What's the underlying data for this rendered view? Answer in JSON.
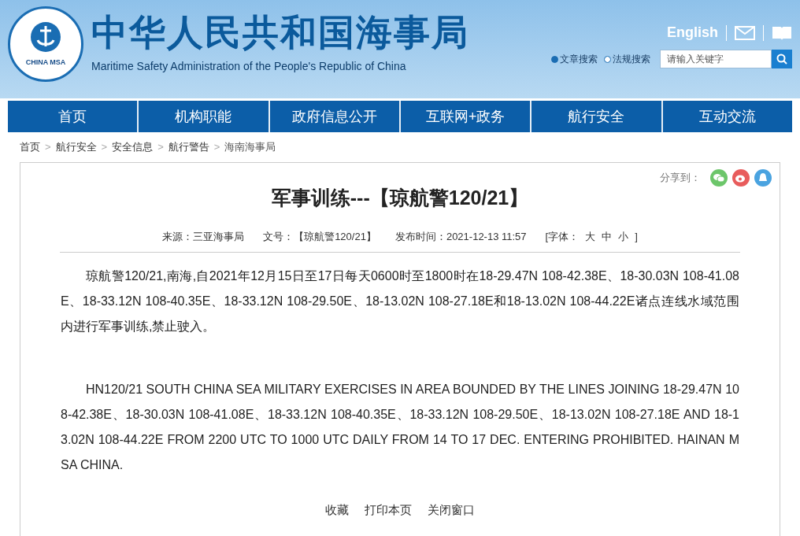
{
  "header": {
    "title": "中华人民共和国海事局",
    "subtitle": "Maritime Safety Administration of the People's Republic of China",
    "logo_text": "CHINA MSA",
    "language_link": "English",
    "search_scopes": [
      {
        "label": "文章搜索",
        "selected": true
      },
      {
        "label": "法规搜索",
        "selected": false
      }
    ],
    "search": {
      "placeholder": "请输入关键字"
    }
  },
  "nav": [
    {
      "label": "首页"
    },
    {
      "label": "机构职能"
    },
    {
      "label": "政府信息公开"
    },
    {
      "label": "互联网+政务"
    },
    {
      "label": "航行安全"
    },
    {
      "label": "互动交流"
    }
  ],
  "breadcrumb": {
    "separator": ">",
    "items": [
      "首页",
      "航行安全",
      "安全信息",
      "航行警告",
      "海南海事局"
    ]
  },
  "article": {
    "share_label": "分享到：",
    "title": "军事训练---【琼航警120/21】",
    "meta": [
      {
        "kind": "text",
        "text": "来源：三亚海事局"
      },
      {
        "kind": "text",
        "text": "文号：【琼航警120/21】"
      },
      {
        "kind": "text",
        "text": "发布时间：2021-12-13 11:57"
      },
      {
        "kind": "font",
        "label": "[字体：",
        "sizes": [
          "大",
          "中",
          "小"
        ],
        "close": "]"
      }
    ],
    "paragraphs": [
      "琼航警120/21,南海,自2021年12月15日至17日每天0600时至1800时在18-29.47N 108-42.38E、18-30.03N 108-41.08E、18-33.12N 108-40.35E、18-33.12N 108-29.50E、18-13.02N 108-27.18E和18-13.02N 108-44.22E诸点连线水域范围内进行军事训练,禁止驶入。",
      "HN120/21 SOUTH CHINA SEA MILITARY EXERCISES IN AREA BOUNDED BY THE LINES JOINING 18-29.47N 108-42.38E、18-30.03N 108-41.08E、18-33.12N 108-40.35E、18-33.12N 108-29.50E、18-13.02N 108-27.18E AND 18-13.02N 108-44.22E FROM 2200 UTC TO 1000 UTC DAILY FROM 14 TO 17 DEC. ENTERING PROHIBITED. HAINAN MSA CHINA."
    ],
    "actions": [
      "收藏",
      "打印本页",
      "关闭窗口"
    ]
  }
}
